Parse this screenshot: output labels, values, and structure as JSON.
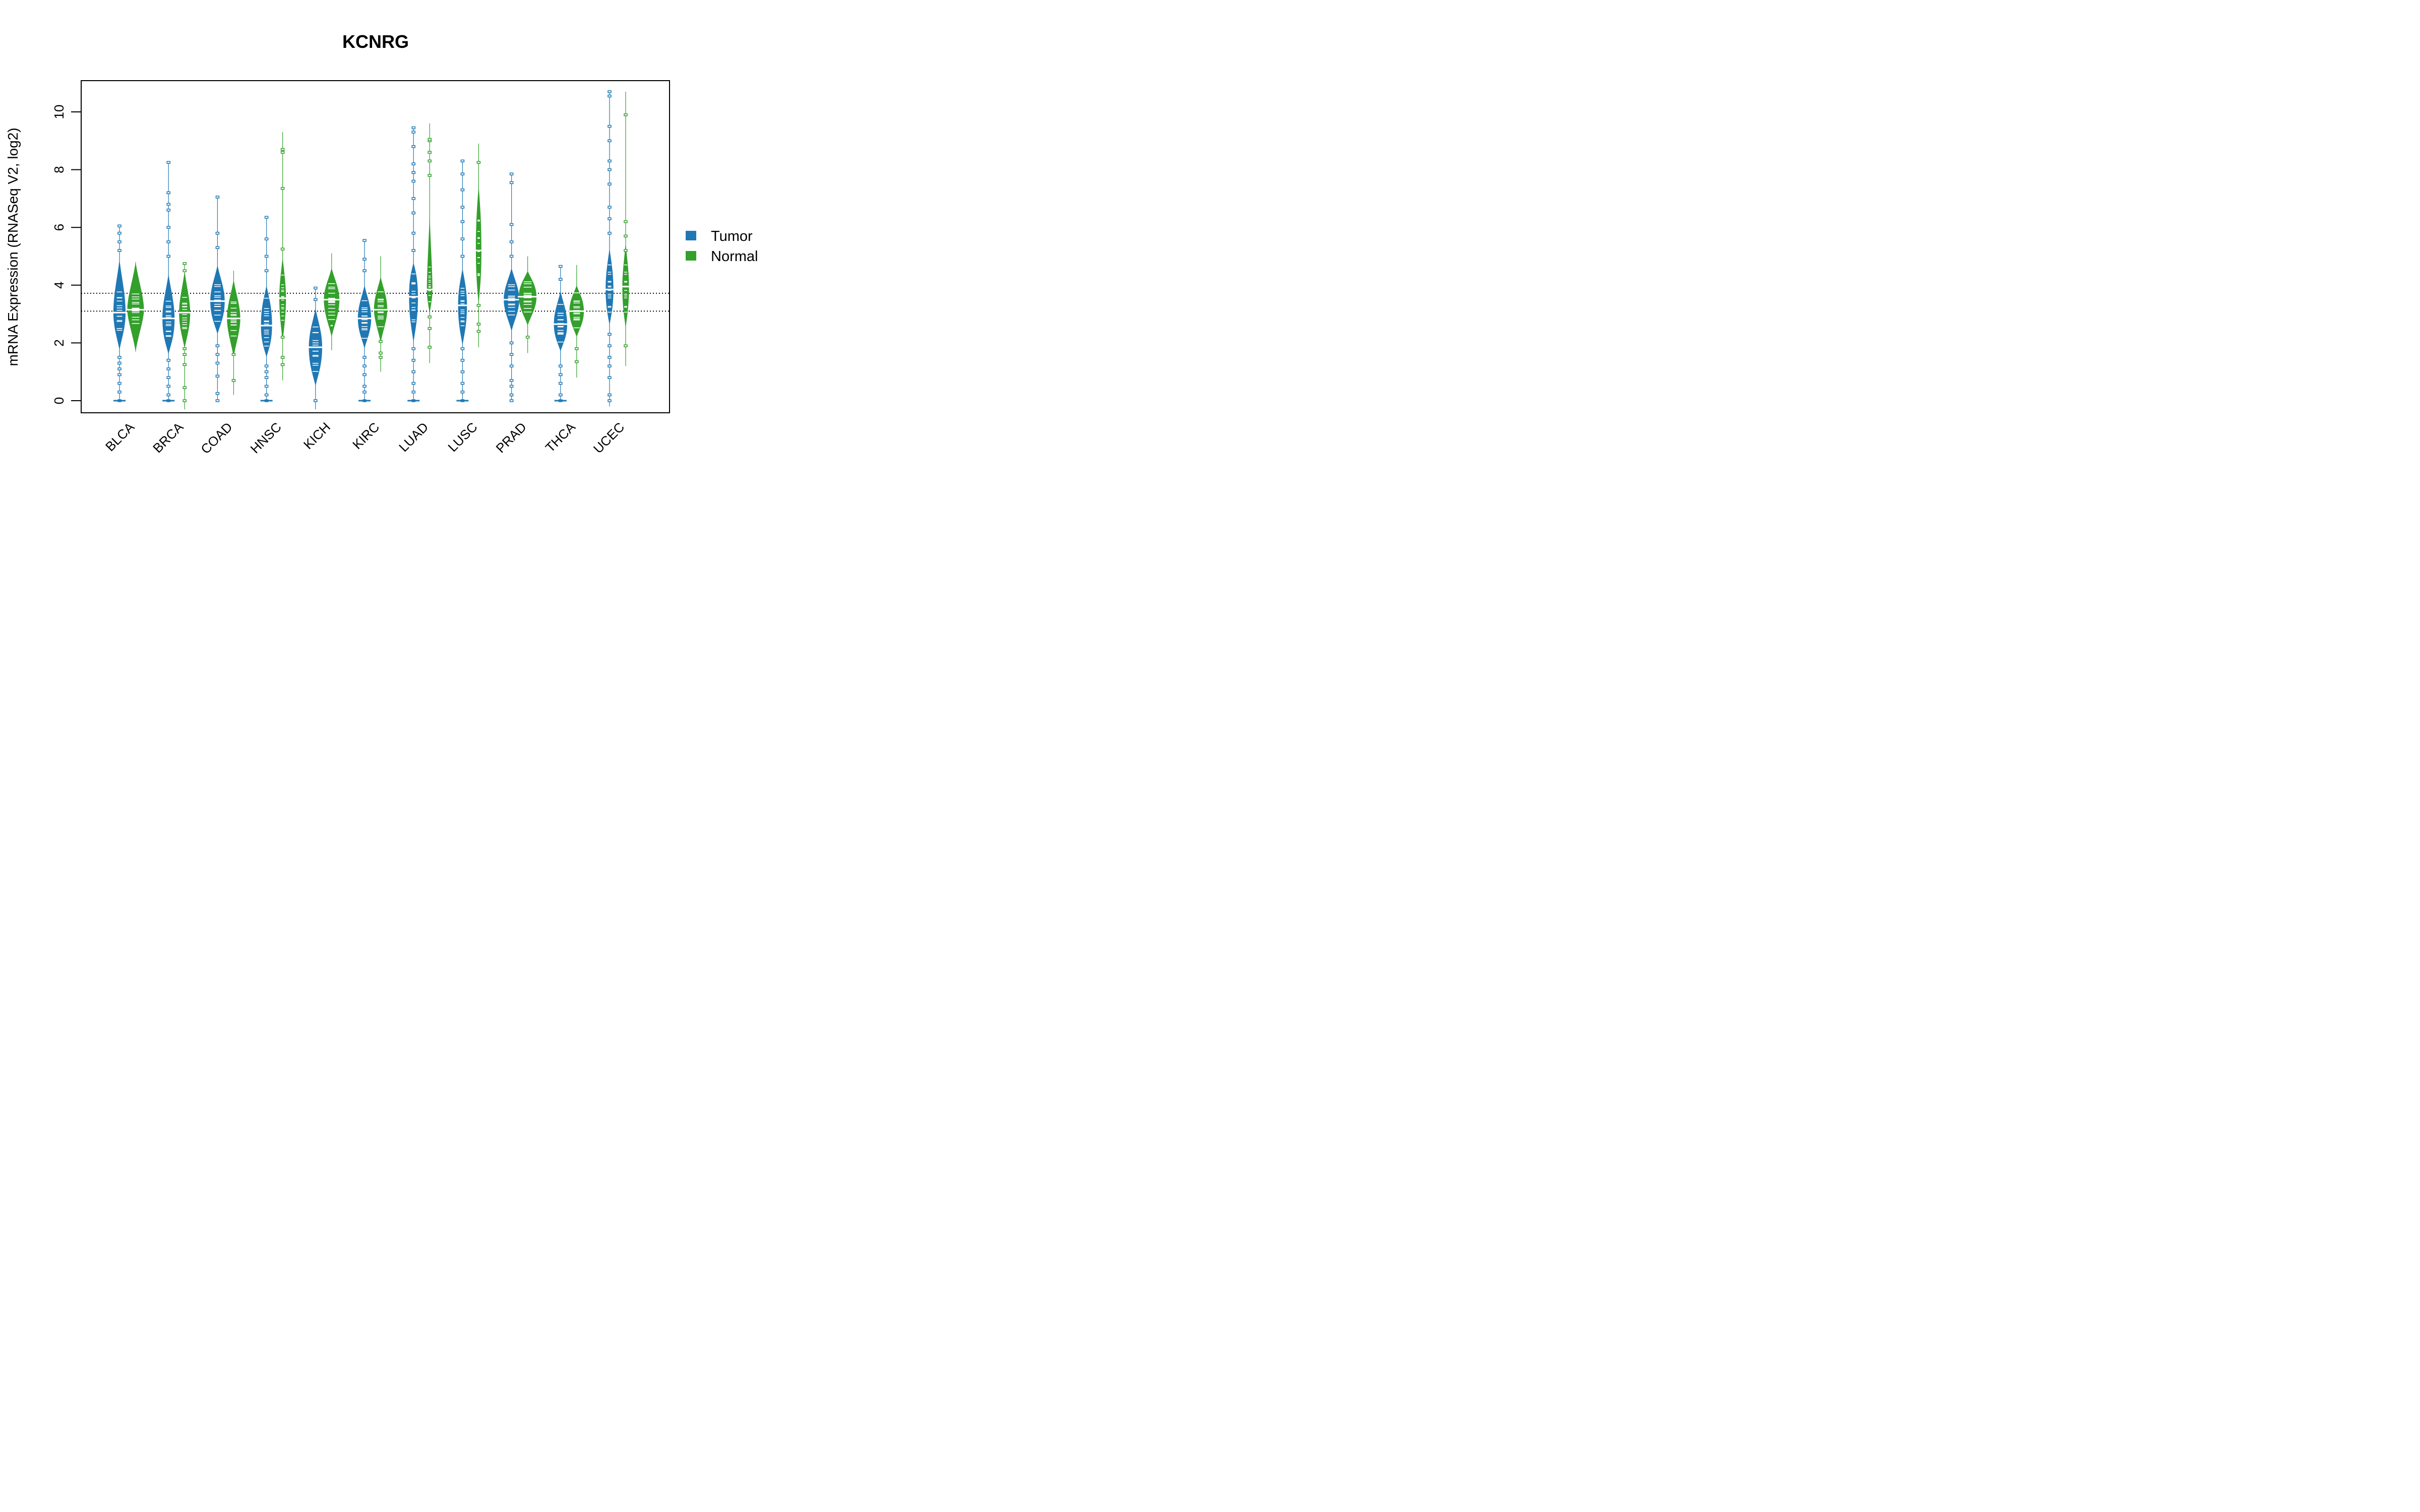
{
  "chart_data": {
    "type": "violin",
    "title": "KCNRG",
    "xlabel": "",
    "ylabel": "mRNA Expression (RNASeq V2, log2)",
    "ylim": [
      -0.4,
      11.1
    ],
    "yticks": [
      0,
      2,
      4,
      6,
      8,
      10
    ],
    "grid": false,
    "legend_position": "right",
    "reference_lines": [
      3.72,
      3.1
    ],
    "categories": [
      "BLCA",
      "BRCA",
      "COAD",
      "HNSC",
      "KICH",
      "KIRC",
      "LUAD",
      "LUSC",
      "PRAD",
      "THCA",
      "UCEC"
    ],
    "series": [
      {
        "name": "Tumor",
        "color": "#1F78B4",
        "groups": [
          {
            "median": 3.05,
            "q1": 2.5,
            "q3": 3.7,
            "body_min": 1.75,
            "body_max": 4.9,
            "min": 0,
            "max": 6.05,
            "width": 0.55,
            "outliers": [
              0,
              0.3,
              0.6,
              0.9,
              1.1,
              1.3,
              1.5,
              5.2,
              5.5,
              5.8,
              6.05
            ]
          },
          {
            "median": 2.85,
            "q1": 2.2,
            "q3": 3.4,
            "body_min": 1.6,
            "body_max": 4.4,
            "min": 0,
            "max": 8.25,
            "width": 0.55,
            "outliers": [
              0,
              0.2,
              0.5,
              0.8,
              1.1,
              1.4,
              5.0,
              5.5,
              6.0,
              6.6,
              6.8,
              7.2,
              8.25
            ]
          },
          {
            "median": 3.45,
            "q1": 2.9,
            "q3": 3.9,
            "body_min": 2.3,
            "body_max": 4.7,
            "min": 0,
            "max": 7.05,
            "width": 0.65,
            "outliers": [
              0,
              0.25,
              0.85,
              1.3,
              1.6,
              1.9,
              5.3,
              5.8,
              7.05
            ]
          },
          {
            "median": 2.6,
            "q1": 2.0,
            "q3": 3.3,
            "body_min": 1.5,
            "body_max": 4.0,
            "min": 0,
            "max": 6.35,
            "width": 0.5,
            "outliers": [
              0,
              0.2,
              0.5,
              0.8,
              1.0,
              1.2,
              4.5,
              5.0,
              5.6,
              6.35
            ]
          },
          {
            "median": 1.85,
            "q1": 1.2,
            "q3": 2.4,
            "body_min": 0.5,
            "body_max": 3.2,
            "min": -0.3,
            "max": 3.9,
            "width": 0.6,
            "outliers": [
              0,
              3.5,
              3.9
            ]
          },
          {
            "median": 2.85,
            "q1": 2.4,
            "q3": 3.3,
            "body_min": 1.8,
            "body_max": 4.0,
            "min": 0,
            "max": 5.55,
            "width": 0.6,
            "outliers": [
              0,
              0.3,
              0.5,
              0.9,
              1.2,
              1.5,
              4.5,
              4.9,
              5.55
            ]
          },
          {
            "median": 3.6,
            "q1": 2.8,
            "q3": 4.3,
            "body_min": 2.0,
            "body_max": 4.8,
            "min": 0,
            "max": 9.45,
            "width": 0.4,
            "outliers": [
              0,
              0.3,
              0.6,
              1.0,
              1.4,
              1.8,
              5.2,
              5.8,
              6.5,
              7.0,
              7.6,
              7.9,
              8.2,
              8.8,
              9.3,
              9.45
            ]
          },
          {
            "median": 3.3,
            "q1": 2.6,
            "q3": 3.9,
            "body_min": 1.9,
            "body_max": 4.6,
            "min": 0,
            "max": 8.3,
            "width": 0.4,
            "outliers": [
              0,
              0.3,
              0.6,
              1.0,
              1.4,
              1.8,
              5.0,
              5.6,
              6.2,
              6.7,
              7.3,
              7.85,
              8.3
            ]
          },
          {
            "median": 3.5,
            "q1": 3.1,
            "q3": 3.9,
            "body_min": 2.4,
            "body_max": 4.6,
            "min": 0,
            "max": 7.85,
            "width": 0.7,
            "outliers": [
              0,
              0.2,
              0.5,
              0.7,
              1.2,
              1.6,
              2.0,
              5.0,
              5.5,
              6.1,
              7.55,
              7.85
            ]
          },
          {
            "median": 2.65,
            "q1": 2.2,
            "q3": 3.1,
            "body_min": 1.7,
            "body_max": 3.8,
            "min": 0,
            "max": 4.65,
            "width": 0.6,
            "outliers": [
              0,
              0.2,
              0.6,
              0.9,
              1.2,
              4.2,
              4.65
            ]
          },
          {
            "median": 3.85,
            "q1": 3.2,
            "q3": 4.5,
            "body_min": 2.6,
            "body_max": 5.3,
            "min": -0.2,
            "max": 10.7,
            "width": 0.35,
            "outliers": [
              0,
              0.2,
              0.8,
              1.2,
              1.5,
              1.9,
              2.3,
              5.8,
              6.3,
              6.7,
              7.5,
              8.0,
              8.3,
              9.0,
              9.5,
              10.55,
              10.7
            ]
          }
        ]
      },
      {
        "name": "Normal",
        "color": "#33A02C",
        "groups": [
          {
            "median": 3.15,
            "q1": 2.8,
            "q3": 3.6,
            "body_min": 1.7,
            "body_max": 4.8,
            "min": 1.7,
            "max": 4.8,
            "width": 0.75,
            "outliers": []
          },
          {
            "median": 3.05,
            "q1": 2.5,
            "q3": 3.5,
            "body_min": 1.8,
            "body_max": 4.5,
            "min": -0.3,
            "max": 4.8,
            "width": 0.5,
            "outliers": [
              0,
              0.45,
              1.25,
              1.6,
              1.8,
              4.5,
              4.75
            ]
          },
          {
            "median": 2.85,
            "q1": 2.4,
            "q3": 3.3,
            "body_min": 1.5,
            "body_max": 4.2,
            "min": 0.2,
            "max": 4.5,
            "width": 0.6,
            "outliers": [
              0.7,
              1.6
            ]
          },
          {
            "median": 3.55,
            "q1": 2.9,
            "q3": 4.1,
            "body_min": 2.0,
            "body_max": 5.0,
            "min": 0.7,
            "max": 9.3,
            "width": 0.3,
            "outliers": [
              1.25,
              1.5,
              2.2,
              5.25,
              7.35,
              8.6,
              8.7
            ]
          },
          {
            "median": 3.5,
            "q1": 3.0,
            "q3": 3.9,
            "body_min": 2.2,
            "body_max": 4.6,
            "min": 1.75,
            "max": 5.1,
            "width": 0.7,
            "outliers": [
              2.6
            ]
          },
          {
            "median": 3.15,
            "q1": 2.8,
            "q3": 3.6,
            "body_min": 2.0,
            "body_max": 4.3,
            "min": 1.0,
            "max": 5.0,
            "width": 0.6,
            "outliers": [
              1.5,
              1.65,
              2.05
            ]
          },
          {
            "median": 3.85,
            "q1": 3.5,
            "q3": 4.5,
            "body_min": 3.0,
            "body_max": 6.5,
            "min": 1.3,
            "max": 9.6,
            "width": 0.25,
            "outliers": [
              1.85,
              2.5,
              2.9,
              7.8,
              8.3,
              8.6,
              9.0,
              9.05
            ]
          },
          {
            "median": 5.2,
            "q1": 4.2,
            "q3": 6.4,
            "body_min": 3.3,
            "body_max": 7.5,
            "min": 1.85,
            "max": 8.9,
            "width": 0.25,
            "outliers": [
              2.4,
              2.65,
              3.3,
              8.25
            ]
          },
          {
            "median": 3.6,
            "q1": 3.2,
            "q3": 4.0,
            "body_min": 2.6,
            "body_max": 4.5,
            "min": 1.65,
            "max": 5.0,
            "width": 0.8,
            "outliers": [
              2.2
            ]
          },
          {
            "median": 3.1,
            "q1": 2.7,
            "q3": 3.5,
            "body_min": 2.2,
            "body_max": 4.0,
            "min": 0.8,
            "max": 4.7,
            "width": 0.65,
            "outliers": [
              1.35,
              1.8
            ]
          },
          {
            "median": 3.95,
            "q1": 3.2,
            "q3": 4.5,
            "body_min": 2.5,
            "body_max": 5.5,
            "min": 1.2,
            "max": 10.7,
            "width": 0.3,
            "outliers": [
              1.9,
              5.2,
              5.7,
              6.2,
              9.9
            ]
          }
        ]
      }
    ]
  }
}
